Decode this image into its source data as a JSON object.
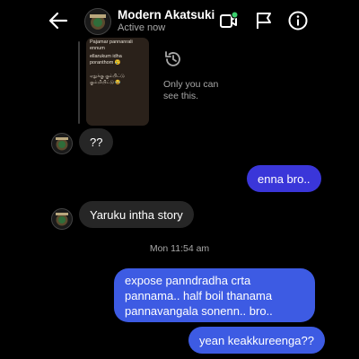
{
  "header": {
    "title": "Modern Akatsuki",
    "status": "Active now",
    "icons": [
      "back-arrow-icon",
      "video-call-icon",
      "flag-icon",
      "info-icon"
    ],
    "active_color": "#3bd16f"
  },
  "story_reply": {
    "thumb_text_line1": "Pajamar pannanrali ennum",
    "thumb_text_line2": "ellarukum idha poranthom 😢",
    "thumb_text_line3": "ஏதுக்கு கும்பிட்டு",
    "thumb_text_line4": "கும்மியிட்டு 😂",
    "only_you_text": "Only you can see this."
  },
  "messages": [
    {
      "side": "received",
      "text": "??"
    },
    {
      "side": "sent",
      "text": "enna bro.."
    },
    {
      "side": "received",
      "text": "Yaruku intha story"
    },
    {
      "side": "sent",
      "text": "expose panndradha crta pannama.. half boil thanama pannavangala sonenn.. bro.."
    },
    {
      "side": "sent",
      "text": "yean keakkureenga??"
    }
  ],
  "timestamp": "Mon 11:54 am",
  "colors": {
    "background": "#000000",
    "received_bubble": "#262626",
    "sent_bubble_purple": "#3a36d9",
    "sent_bubble_blue": "#3d5be3"
  }
}
